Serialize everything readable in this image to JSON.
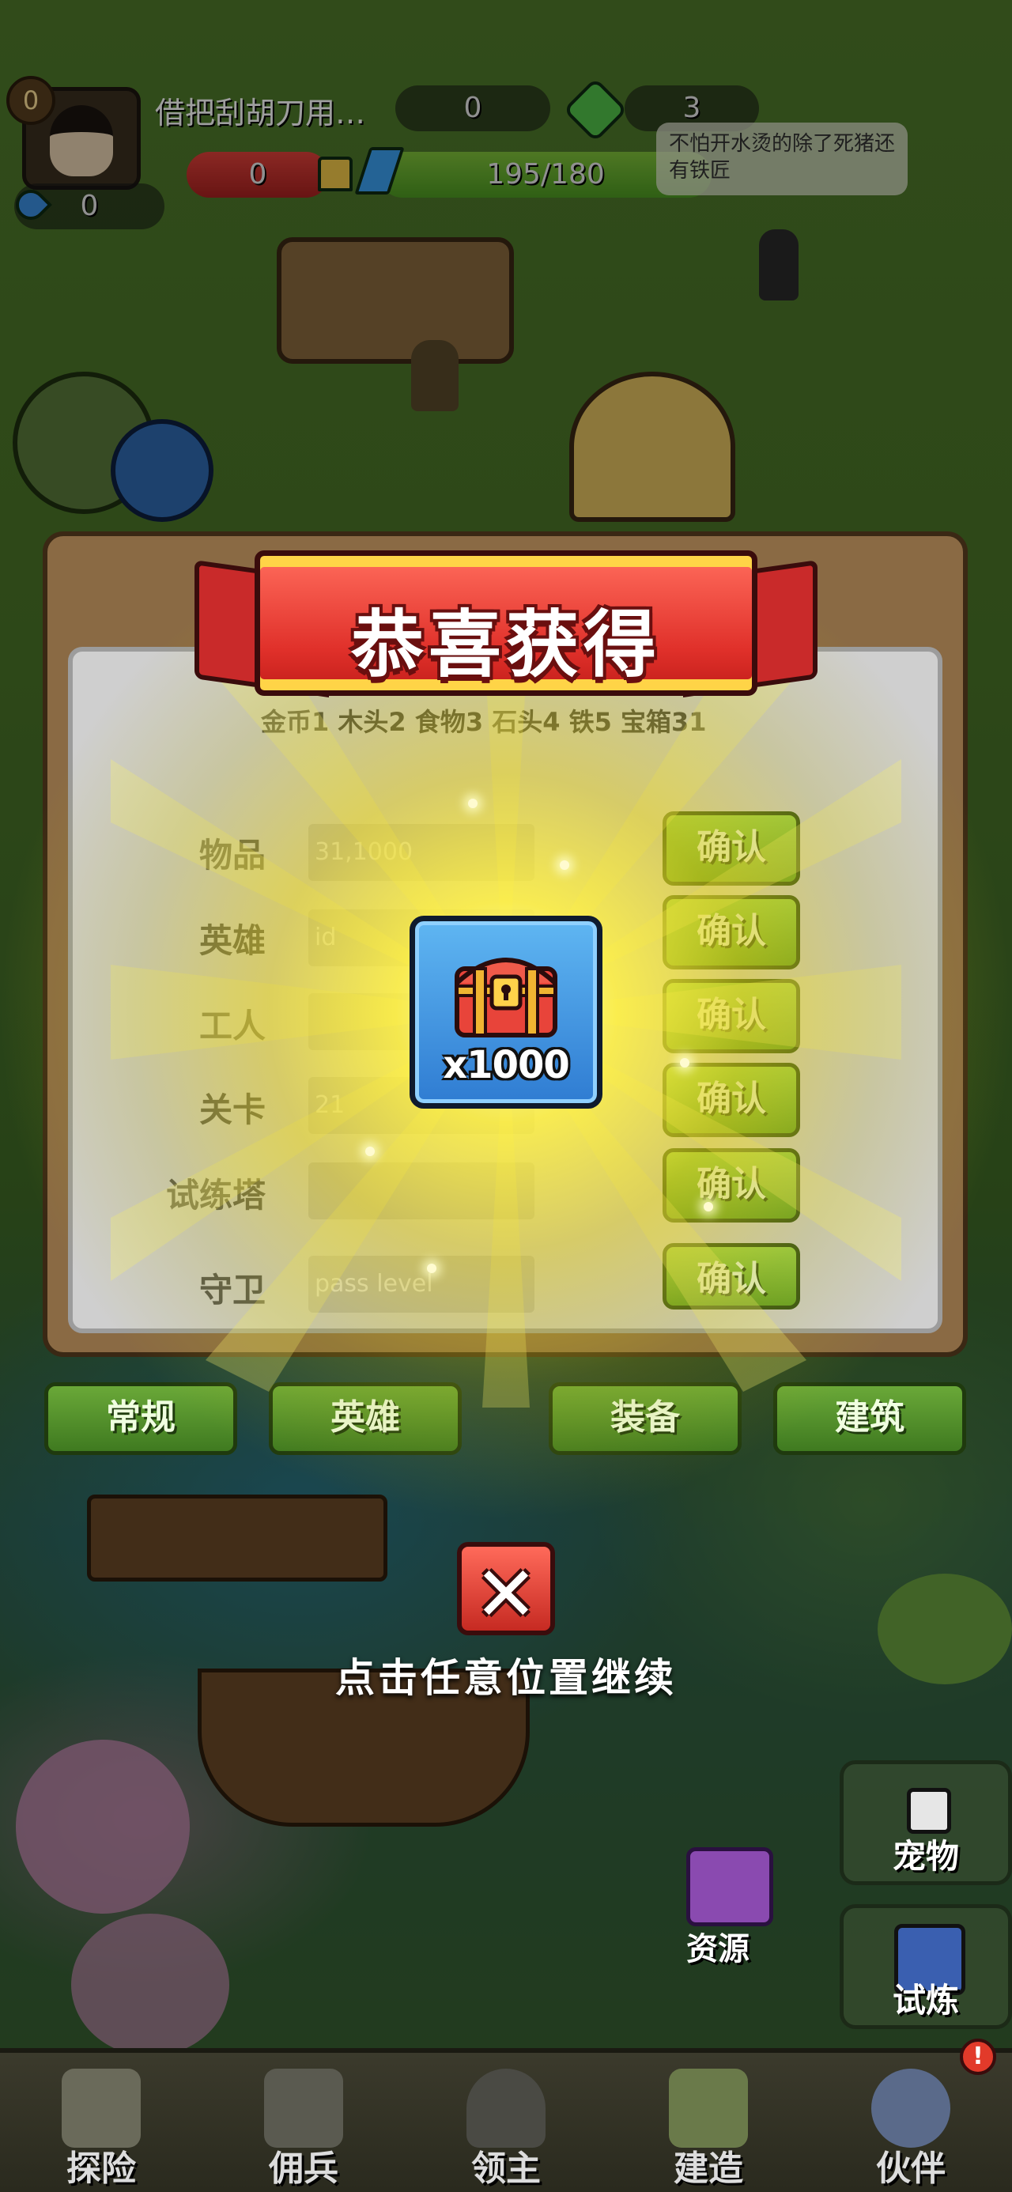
{
  "hud": {
    "player_level": "0",
    "player_name": "借把刮胡刀用…",
    "stat_top_center": "0",
    "stat_top_right": "3",
    "stat_red": "0",
    "energy": "195/180",
    "stat_blue": "0",
    "speech_bubble": "不怕开水烫的除了死猪还有铁匠"
  },
  "modal": {
    "title": "恭喜获得",
    "rule_text": "金币1 木头2 食物3 石头4 铁5 宝箱31",
    "rows": [
      {
        "label": "物品",
        "value": "31,1000",
        "button": "确认"
      },
      {
        "label": "英雄",
        "value": "id",
        "button": "确认"
      },
      {
        "label": "工人",
        "value": "",
        "button": "确认"
      },
      {
        "label": "关卡",
        "value": "21",
        "button": "确认"
      },
      {
        "label": "试练塔",
        "value": "",
        "button": "确认"
      },
      {
        "label": "守卫",
        "value": "pass level",
        "button": "确认"
      }
    ],
    "tabs": [
      "常规",
      "英雄",
      "装备",
      "建筑"
    ],
    "reward": {
      "icon": "treasure-chest-icon",
      "quantity": "x1000"
    },
    "continue_hint": "点击任意位置继续"
  },
  "side": {
    "pet_label": "宠物",
    "trial_label": "试炼",
    "resource_label": "资源"
  },
  "bottom_nav": [
    {
      "label": "探险",
      "icon": "map-icon"
    },
    {
      "label": "佣兵",
      "icon": "armor-icon"
    },
    {
      "label": "领主",
      "icon": "helmet-icon"
    },
    {
      "label": "建造",
      "icon": "hammer-icon"
    },
    {
      "label": "伙伴",
      "icon": "companion-icon",
      "badge": "!"
    }
  ],
  "colors": {
    "confirm_green": "#7fbf3a",
    "ribbon_red": "#e0302a",
    "ribbon_gold": "#ffd447",
    "reward_blue": "#3f8fe0",
    "glow_yellow": "#fff04a"
  }
}
